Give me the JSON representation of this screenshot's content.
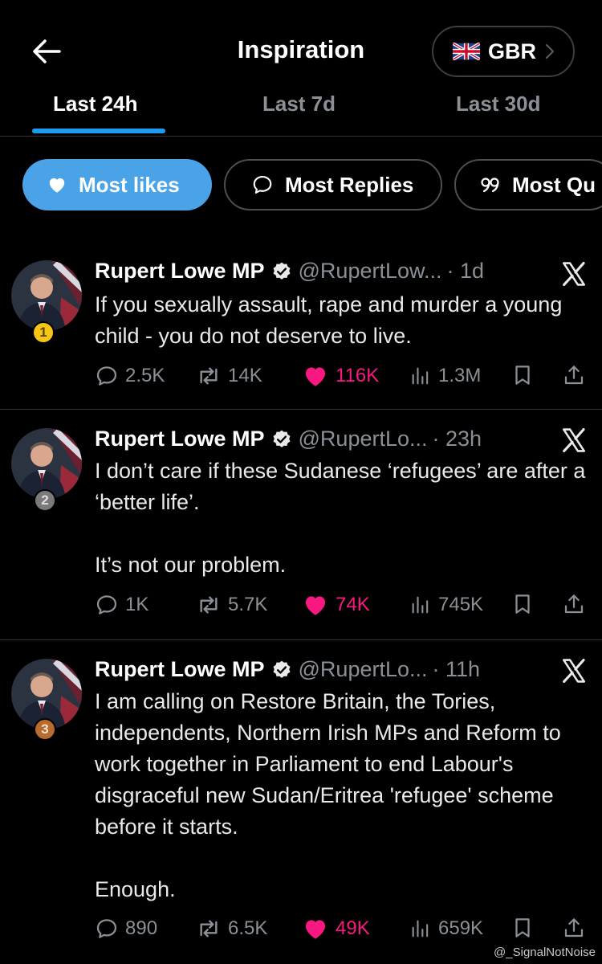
{
  "header": {
    "title": "Inspiration",
    "country": "GBR"
  },
  "tabs": [
    {
      "label": "Last 24h",
      "active": true
    },
    {
      "label": "Last 7d",
      "active": false
    },
    {
      "label": "Last 30d",
      "active": false
    }
  ],
  "filters": [
    {
      "label": "Most likes",
      "icon": "heart-icon",
      "active": true
    },
    {
      "label": "Most Replies",
      "icon": "speech-bubble-icon",
      "active": false
    },
    {
      "label": "Most Qu",
      "icon": "quote-icon",
      "active": false
    }
  ],
  "tweets": [
    {
      "rank": "1",
      "name": "Rupert Lowe MP",
      "handle": "@RupertLow...",
      "time": "· 1d",
      "text": [
        "If you sexually assault, rape and murder a young child - you do not deserve to live."
      ],
      "replies": "2.5K",
      "reposts": "14K",
      "likes": "116K",
      "views": "1.3M"
    },
    {
      "rank": "2",
      "name": "Rupert Lowe MP",
      "handle": "@RupertLo...",
      "time": "· 23h",
      "text": [
        "I don’t care if these Sudanese ‘refugees’ are after a ‘better life’.",
        "It’s not our problem."
      ],
      "replies": "1K",
      "reposts": "5.7K",
      "likes": "74K",
      "views": "745K"
    },
    {
      "rank": "3",
      "name": "Rupert Lowe MP",
      "handle": "@RupertLo...",
      "time": "· 11h",
      "text": [
        "I am calling on Restore Britain, the Tories, independents, Northern Irish MPs and Reform to work together in Parliament to end Labour's disgraceful new Sudan/Eritrea 'refugee' scheme before it starts.",
        "Enough."
      ],
      "replies": "890",
      "reposts": "6.5K",
      "likes": "49K",
      "views": "659K"
    }
  ],
  "watermark": "@_SignalNotNoise",
  "colors": {
    "accent": "#1d9bf0",
    "pill_active": "#4aa3e6",
    "like": "#f91880",
    "rank1": "#f5c518",
    "rank2": "#7a7a7a",
    "rank3": "#b86b2e"
  }
}
